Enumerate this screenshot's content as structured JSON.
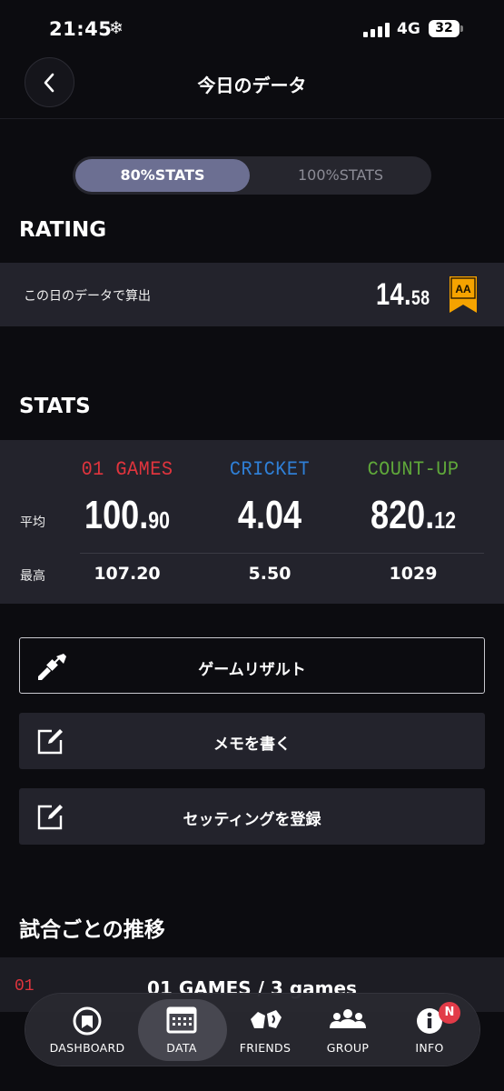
{
  "status": {
    "time": "21:45",
    "snow_icon": "❄",
    "network": "4G",
    "battery": "32"
  },
  "header": {
    "title": "今日のデータ"
  },
  "tabs": {
    "left": "80%STATS",
    "right": "100%STATS",
    "selected": "80%STATS"
  },
  "rating": {
    "section_title": "RATING",
    "label": "この日のデータで算出",
    "value_int": "14.",
    "value_dec": "58",
    "badge": "AA",
    "badge_color": "#f5a300"
  },
  "stats": {
    "section_title": "STATS",
    "columns": [
      {
        "name": "01 GAMES",
        "color": "#e0343d",
        "avg_int": "100.",
        "avg_dec": "90",
        "max": "107.20"
      },
      {
        "name": "CRICKET",
        "color": "#2f7fd6",
        "avg_int": "4.04",
        "avg_dec": "",
        "max": "5.50"
      },
      {
        "name": "COUNT-UP",
        "color": "#5fa83a",
        "avg_int": "820.",
        "avg_dec": "12",
        "max": "1029"
      }
    ],
    "row_avg": "平均",
    "row_max": "最高"
  },
  "actions": [
    {
      "label": "ゲームリザルト",
      "icon": "dart-icon"
    },
    {
      "label": "メモを書く",
      "icon": "edit-icon"
    },
    {
      "label": "セッティングを登録",
      "icon": "edit-icon"
    }
  ],
  "trend": {
    "section_title": "試合ごとの推移",
    "badge": "01",
    "text": "01 GAMES / 3 games"
  },
  "nav": {
    "items": [
      {
        "label": "DASHBOARD",
        "icon": "dashboard-icon"
      },
      {
        "label": "DATA",
        "icon": "data-icon"
      },
      {
        "label": "FRIENDS",
        "icon": "friends-icon"
      },
      {
        "label": "GROUP",
        "icon": "group-icon"
      },
      {
        "label": "INFO",
        "icon": "info-icon"
      }
    ],
    "active": "DATA",
    "notification": "N"
  }
}
